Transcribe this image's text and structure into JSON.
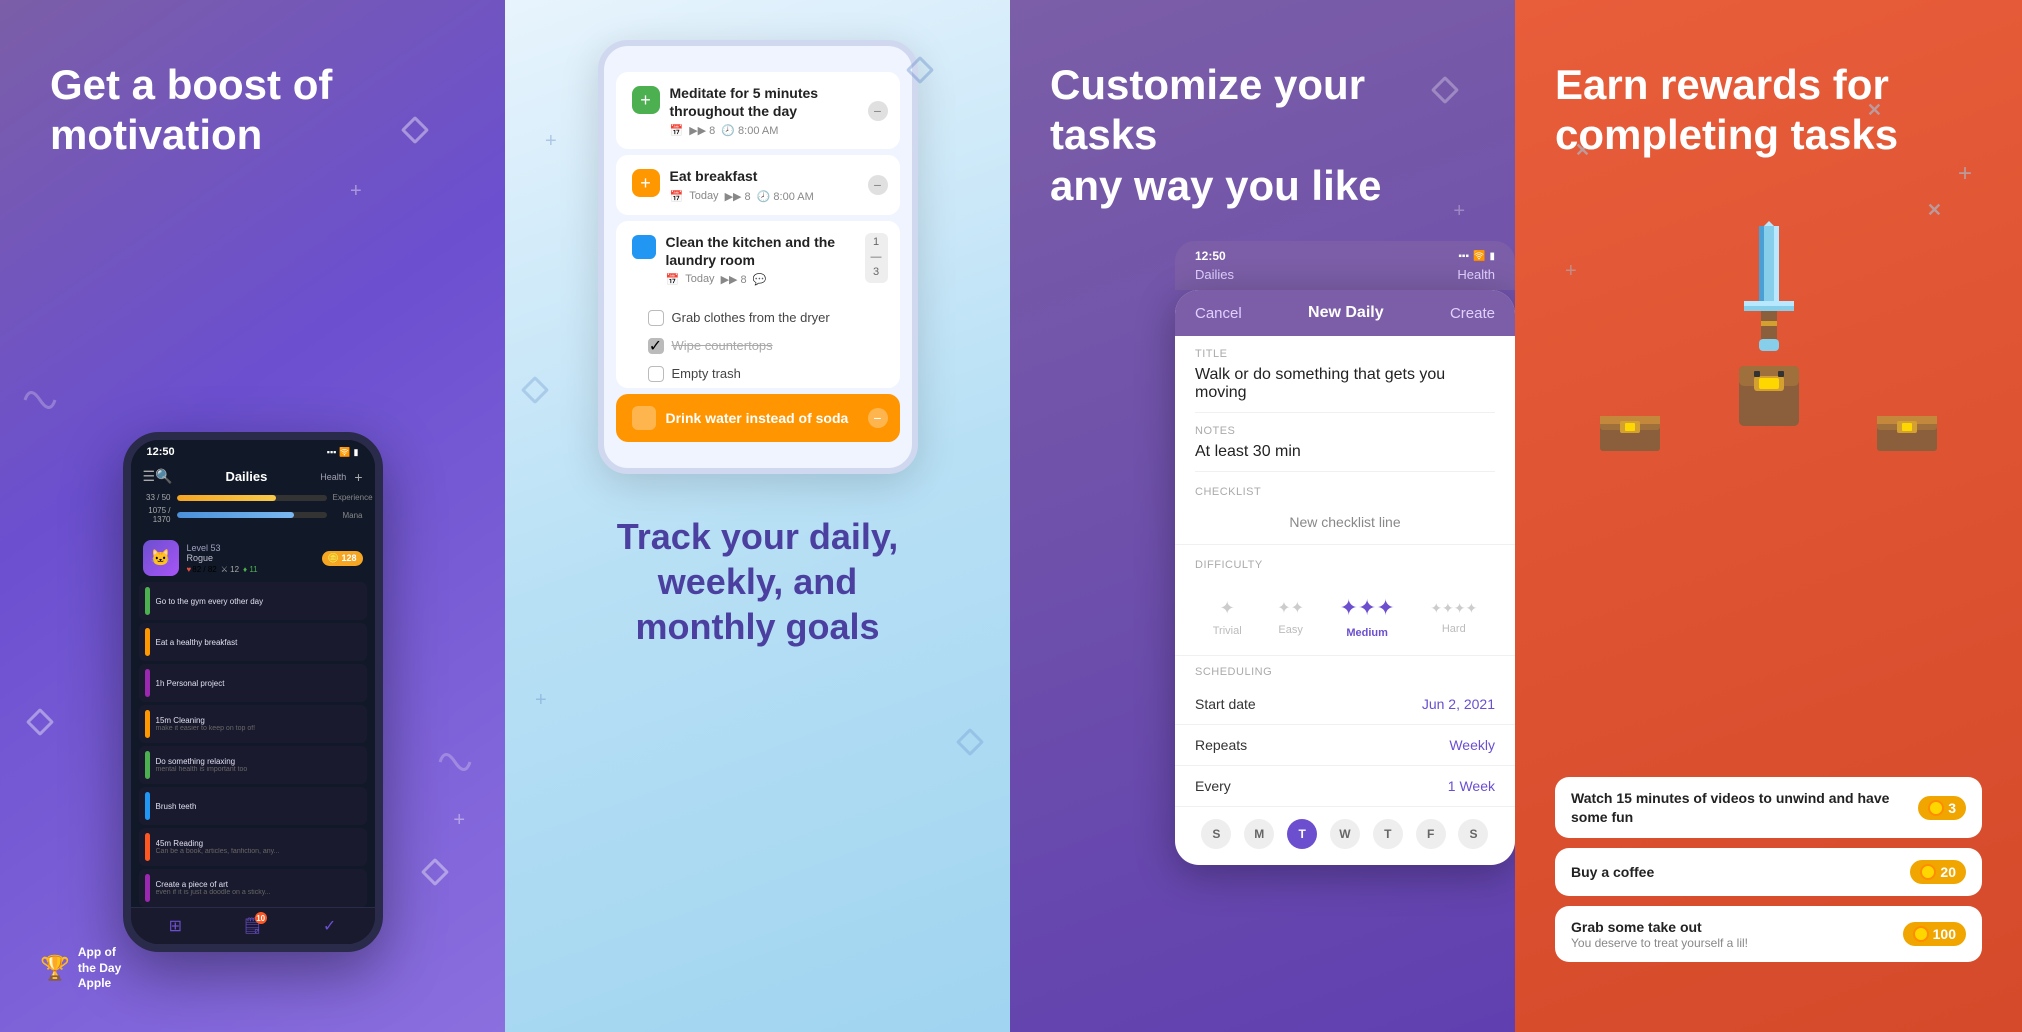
{
  "panel1": {
    "headline": "Get a boost of\nmotivation",
    "phone": {
      "time": "12:50",
      "title": "Dailies",
      "health_label": "Health",
      "exp_label": "Experience",
      "mana_label": "Mana",
      "level": "Level 53",
      "class": "Rogue",
      "hp": "82 / 82",
      "mana": "1075 / 1370",
      "exp": "33 / 50",
      "tasks": [
        {
          "label": "Go to the gym every other day",
          "color": "#4CAF50",
          "sub": ""
        },
        {
          "label": "Eat a healthy breakfast",
          "color": "#FF9800",
          "sub": ""
        },
        {
          "label": "1h Personal project",
          "color": "#9C27B0",
          "sub": ""
        },
        {
          "label": "15m Cleaning",
          "color": "#FF9800",
          "sub": "make it easier to keep on top of!"
        },
        {
          "label": "Do something relaxing",
          "color": "#4CAF50",
          "sub": "mental health is important too"
        },
        {
          "label": "Brush teeth",
          "color": "#2196F3",
          "sub": ""
        },
        {
          "label": "45m Reading",
          "color": "#FF5722",
          "sub": "Can be a book, articles, fanfiction, any..."
        },
        {
          "label": "Create a piece of art",
          "color": "#9C27B0",
          "sub": "even if it is just a doodle on a sticky..."
        }
      ]
    },
    "badge_line1": "App of",
    "badge_line2": "the Day",
    "badge_company": "Apple"
  },
  "panel2": {
    "tasks": [
      {
        "id": "meditate",
        "checkbox_color": "#4CAF50",
        "plus_color": "#4CAF50",
        "title": "Meditate for 5 minutes throughout the day",
        "has_minus": true,
        "meta_icon": "📅",
        "meta_text": "",
        "time": "8:00 AM",
        "counter": "8"
      },
      {
        "id": "breakfast",
        "checkbox_color": "#FF9800",
        "plus_color": "#FF9800",
        "title": "Eat breakfast",
        "has_minus": true,
        "meta_text": "Today",
        "counter": "8",
        "time": "8:00 AM"
      },
      {
        "id": "kitchen",
        "checkbox_color": "#2196F3",
        "plus_color": "#2196F3",
        "title": "Clean the kitchen and the laundry room",
        "has_minus": false,
        "meta_text": "Today",
        "counter_top": "1",
        "counter_bottom": "3",
        "checklist": [
          {
            "text": "Grab clothes from the dryer",
            "done": false
          },
          {
            "text": "Wipe countertops",
            "done": true
          },
          {
            "text": "Empty trash",
            "done": false
          }
        ]
      }
    ],
    "orange_task": {
      "title": "Drink water instead of soda",
      "has_minus": true
    },
    "tagline_line1": "Track your daily,",
    "tagline_line2": "weekly, and",
    "tagline_line3": "monthly goals"
  },
  "panel3": {
    "headline_line1": "Customize your tasks",
    "headline_line2": "any way you like",
    "form": {
      "cancel": "Cancel",
      "title": "New Daily",
      "create": "Create",
      "title_label": "Title",
      "title_value": "Walk or do something that gets you moving",
      "notes_label": "Notes",
      "notes_value": "At least 30 min",
      "checklist_label": "CHECKLIST",
      "checklist_placeholder": "New checklist line",
      "difficulty_label": "DIFFICULTY",
      "difficulties": [
        {
          "id": "trivial",
          "label": "Trivial",
          "active": false,
          "icon": "✦"
        },
        {
          "id": "easy",
          "label": "Easy",
          "active": false,
          "icon": "✦✦"
        },
        {
          "id": "medium",
          "label": "Medium",
          "active": true,
          "icon": "✦✦✦"
        },
        {
          "id": "hard",
          "label": "Hard",
          "active": false,
          "icon": "✦✦✦✦"
        }
      ],
      "scheduling_label": "SCHEDULING",
      "start_date_label": "Start date",
      "start_date_value": "Jun 2, 2021",
      "repeats_label": "Repeats",
      "repeats_value": "Weekly",
      "every_label": "Every",
      "every_value": "1 Week",
      "days": [
        {
          "label": "S",
          "active": false
        },
        {
          "label": "M",
          "active": false
        },
        {
          "label": "T",
          "active": true
        },
        {
          "label": "W",
          "active": false
        },
        {
          "label": "T",
          "active": false
        },
        {
          "label": "F",
          "active": false
        },
        {
          "label": "S",
          "active": false
        }
      ]
    }
  },
  "panel4": {
    "headline_line1": "Earn rewards for",
    "headline_line2": "completing tasks",
    "rewards": [
      {
        "title": "Watch 15 minutes of videos to unwind and have some fun",
        "sub": "",
        "coins": "3"
      },
      {
        "title": "Buy a coffee",
        "sub": "",
        "coins": "20"
      },
      {
        "title": "Grab some take out",
        "sub": "You deserve to treat yourself a lil!",
        "coins": "100"
      }
    ]
  }
}
